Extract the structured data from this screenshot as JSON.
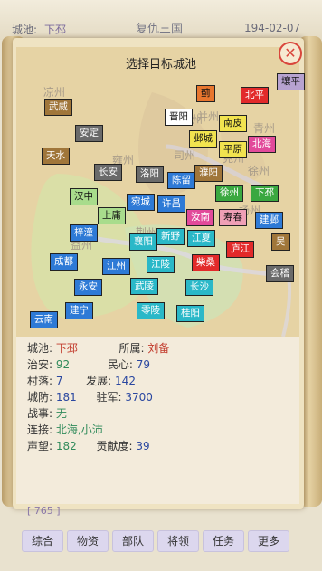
{
  "topbar": {
    "city_label": "城池:",
    "city_value": "下邳",
    "title": "复仇三国",
    "date": "194-02-07"
  },
  "dialog": {
    "title": "选择目标城池",
    "close_symbol": "✕"
  },
  "regions": [
    "凉州",
    "雍州",
    "冀州",
    "青州",
    "并州",
    "司州",
    "兖州",
    "徐州",
    "益州",
    "荆州",
    "扬州"
  ],
  "cities": [
    {
      "name": "蓟",
      "color": "#e8762e"
    },
    {
      "name": "北平",
      "color": "#e22a2a"
    },
    {
      "name": "壤平",
      "color": "#b7a2d0"
    },
    {
      "name": "武威",
      "color": "#a0763a"
    },
    {
      "name": "晋阳",
      "color": "#ffffff"
    },
    {
      "name": "南皮",
      "color": "#f1e34f"
    },
    {
      "name": "安定",
      "color": "#6a6a6a"
    },
    {
      "name": "邺城",
      "color": "#f1e34f"
    },
    {
      "name": "北海",
      "color": "#e24a9a"
    },
    {
      "name": "平原",
      "color": "#f1e34f"
    },
    {
      "name": "天水",
      "color": "#a0763a"
    },
    {
      "name": "长安",
      "color": "#6a6a6a"
    },
    {
      "name": "洛阳",
      "color": "#6a6a6a"
    },
    {
      "name": "濮阳",
      "color": "#a0763a"
    },
    {
      "name": "陈留",
      "color": "#2e7ad6"
    },
    {
      "name": "徐州",
      "color": "#3aa840"
    },
    {
      "name": "下邳",
      "color": "#3aa840"
    },
    {
      "name": "汉中",
      "color": "#a8dc8c"
    },
    {
      "name": "宛城",
      "color": "#2e7ad6"
    },
    {
      "name": "许昌",
      "color": "#2e7ad6"
    },
    {
      "name": "上庸",
      "color": "#a8dc8c"
    },
    {
      "name": "汝南",
      "color": "#e24a9a"
    },
    {
      "name": "寿春",
      "color": "#ef9fb6"
    },
    {
      "name": "建邺",
      "color": "#2e7ad6"
    },
    {
      "name": "梓潼",
      "color": "#2e7ad6"
    },
    {
      "name": "襄阳",
      "color": "#2ab8c8"
    },
    {
      "name": "新野",
      "color": "#2ab8c8"
    },
    {
      "name": "江夏",
      "color": "#2ab8c8"
    },
    {
      "name": "庐江",
      "color": "#e22a2a"
    },
    {
      "name": "吴",
      "color": "#a0763a"
    },
    {
      "name": "成都",
      "color": "#2e7ad6"
    },
    {
      "name": "江州",
      "color": "#2e7ad6"
    },
    {
      "name": "江陵",
      "color": "#2ab8c8"
    },
    {
      "name": "柴桑",
      "color": "#e22a2a"
    },
    {
      "name": "会稽",
      "color": "#6a6a6a"
    },
    {
      "name": "永安",
      "color": "#2e7ad6"
    },
    {
      "name": "武陵",
      "color": "#2ab8c8"
    },
    {
      "name": "长沙",
      "color": "#2ab8c8"
    },
    {
      "name": "建宁",
      "color": "#2e7ad6"
    },
    {
      "name": "零陵",
      "color": "#2ab8c8"
    },
    {
      "name": "桂阳",
      "color": "#2ab8c8"
    },
    {
      "name": "云南",
      "color": "#2e7ad6"
    }
  ],
  "info": {
    "city_label": "城池:",
    "city_value": "下邳",
    "owner_label": "所属:",
    "owner_value": "刘备",
    "security_label": "治安:",
    "security_value": "92",
    "morale_label": "民心:",
    "morale_value": "79",
    "village_label": "村落:",
    "village_value": "7",
    "develop_label": "发展:",
    "develop_value": "142",
    "defense_label": "城防:",
    "defense_value": "181",
    "troops_label": "驻军:",
    "troops_value": "3700",
    "war_label": "战事:",
    "war_value": "无",
    "links_label": "连接:",
    "links_value": "北海,小沛",
    "fame_label": "声望:",
    "fame_value": "182",
    "contrib_label": "贡献度:",
    "contrib_value": "39"
  },
  "bottom_count": "[ 765 ]",
  "tabs": [
    "综合",
    "物资",
    "部队",
    "将领",
    "任务",
    "更多"
  ]
}
